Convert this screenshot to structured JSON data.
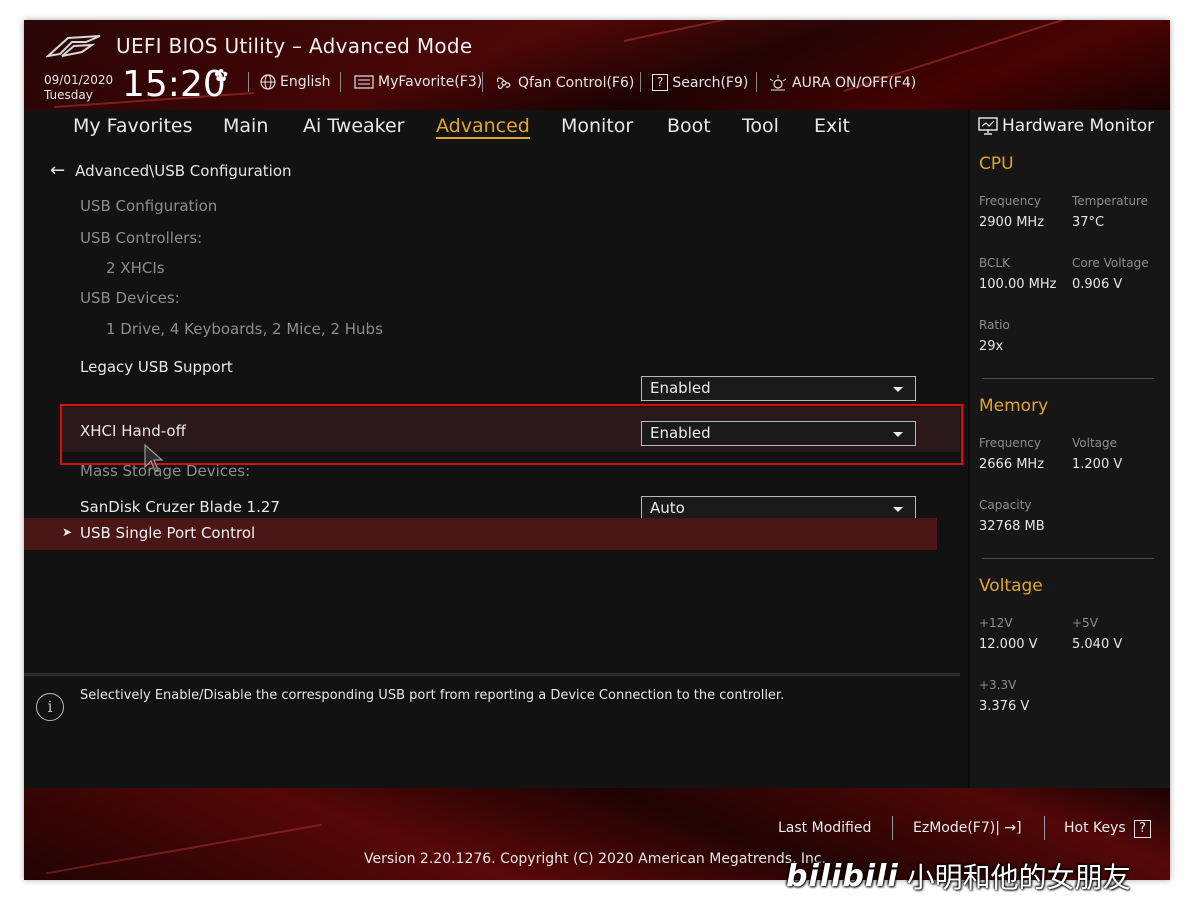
{
  "header": {
    "title": "UEFI BIOS Utility – Advanced Mode",
    "date": "09/01/2020",
    "day": "Tuesday",
    "time": "15:20",
    "language": "English",
    "myfavorite": "MyFavorite(F3)",
    "qfan": "Qfan Control(F6)",
    "search": "Search(F9)",
    "aura": "AURA ON/OFF(F4)"
  },
  "tabs": [
    {
      "label": "My Favorites"
    },
    {
      "label": "Main"
    },
    {
      "label": "Ai Tweaker"
    },
    {
      "label": "Advanced",
      "active": true
    },
    {
      "label": "Monitor"
    },
    {
      "label": "Boot"
    },
    {
      "label": "Tool"
    },
    {
      "label": "Exit"
    }
  ],
  "main": {
    "breadcrumb": "Advanced\\USB Configuration",
    "usb_configuration": "USB Configuration",
    "usb_controllers_label": "USB Controllers:",
    "usb_controllers_value": "2 XHCIs",
    "usb_devices_label": "USB Devices:",
    "usb_devices_value": "1 Drive, 4 Keyboards, 2 Mice, 2 Hubs",
    "legacy_usb_label": "Legacy USB Support",
    "legacy_usb_value": "Enabled",
    "xhci_label": "XHCI Hand-off",
    "xhci_value": "Enabled",
    "mass_storage_label": "Mass Storage Devices:",
    "sandisk_label": "SanDisk Cruzer Blade 1.27",
    "sandisk_value": "Auto",
    "usb_single_port": "USB Single Port Control"
  },
  "help": {
    "text": "Selectively Enable/Disable the corresponding USB port from reporting a Device Connection to the controller."
  },
  "hwmon": {
    "title": "Hardware Monitor",
    "cpu": {
      "heading": "CPU",
      "frequency_label": "Frequency",
      "frequency": "2900 MHz",
      "temperature_label": "Temperature",
      "temperature": "37°C",
      "bclk_label": "BCLK",
      "bclk": "100.00 MHz",
      "core_voltage_label": "Core Voltage",
      "core_voltage": "0.906 V",
      "ratio_label": "Ratio",
      "ratio": "29x"
    },
    "memory": {
      "heading": "Memory",
      "frequency_label": "Frequency",
      "frequency": "2666 MHz",
      "voltage_label": "Voltage",
      "voltage": "1.200 V",
      "capacity_label": "Capacity",
      "capacity": "32768 MB"
    },
    "voltage": {
      "heading": "Voltage",
      "v12_label": "+12V",
      "v12": "12.000 V",
      "v5_label": "+5V",
      "v5": "5.040 V",
      "v33_label": "+3.3V",
      "v33": "3.376 V"
    }
  },
  "footer": {
    "last_modified": "Last Modified",
    "ezmode": "EzMode(F7)|",
    "hotkeys": "Hot Keys",
    "hotkeys_key": "?",
    "version": "Version 2.20.1276. Copyright (C) 2020 American Megatrends, Inc."
  },
  "watermark": {
    "logo": "bilibili",
    "text": "小明和他的女朋友"
  },
  "colors": {
    "accent": "#e2a52b",
    "highlight_border": "#e00b0b",
    "selected_row": "#4a1616"
  }
}
